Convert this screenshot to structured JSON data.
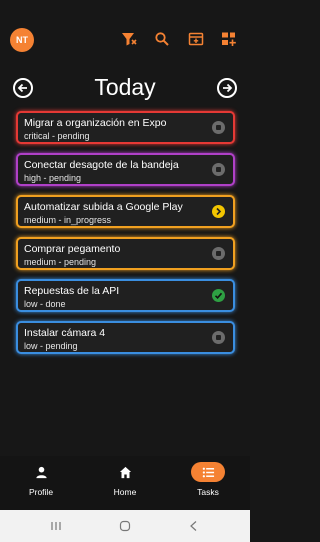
{
  "app_bar": {
    "avatar_initials": "NT",
    "icons": [
      "filter-clear-icon",
      "search-icon",
      "calendar-add-icon",
      "playlist-add-icon"
    ]
  },
  "day": {
    "title": "Today"
  },
  "tasks": [
    {
      "title": "Migrar a organización en Expo",
      "meta": "critical - pending",
      "status": "pending",
      "color": "#e53935"
    },
    {
      "title": "Conectar desagote de la bandeja",
      "meta": "high - pending",
      "status": "pending",
      "color": "#b040c8"
    },
    {
      "title": "Automatizar subida a Google Play",
      "meta": "medium - in_progress",
      "status": "in_progress",
      "color": "#f0a020"
    },
    {
      "title": "Comprar pegamento",
      "meta": "medium - pending",
      "status": "pending",
      "color": "#f0a020"
    },
    {
      "title": "Repuestas de la API",
      "meta": "low - done",
      "status": "done",
      "color": "#3a8ee0"
    },
    {
      "title": "Instalar cámara 4",
      "meta": "low - pending",
      "status": "pending",
      "color": "#3a8ee0"
    }
  ],
  "bottom_nav": {
    "items": [
      {
        "label": "Profile",
        "icon": "person-icon",
        "active": false
      },
      {
        "label": "Home",
        "icon": "home-icon",
        "active": false
      },
      {
        "label": "Tasks",
        "icon": "list-icon",
        "active": true
      }
    ]
  },
  "colors": {
    "accent": "#f58233",
    "background": "#171717"
  }
}
